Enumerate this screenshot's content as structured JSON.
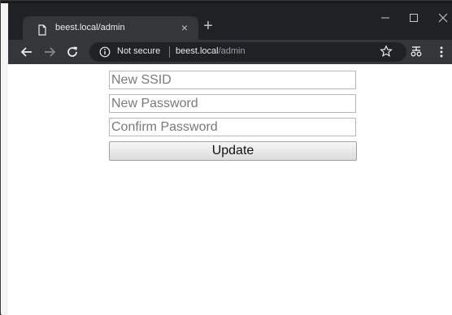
{
  "browser": {
    "tab_title": "beest.local/admin",
    "tab_close_glyph": "×",
    "new_tab_glyph": "+",
    "security_text": "Not secure",
    "url_host": "beest.local",
    "url_path": "/admin",
    "icons": [
      "page-icon",
      "back-arrow-icon",
      "forward-arrow-icon",
      "reload-icon",
      "info-icon",
      "star-icon",
      "extension-icon",
      "menu-icon",
      "minimize-icon",
      "maximize-icon",
      "close-icon"
    ]
  },
  "form": {
    "ssid_placeholder": "New SSID",
    "password_placeholder": "New Password",
    "confirm_placeholder": "Confirm Password",
    "submit_label": "Update"
  },
  "colors": {
    "titlebar": "#202124",
    "tab_active": "#35363a",
    "page_background": "#ffffff"
  }
}
